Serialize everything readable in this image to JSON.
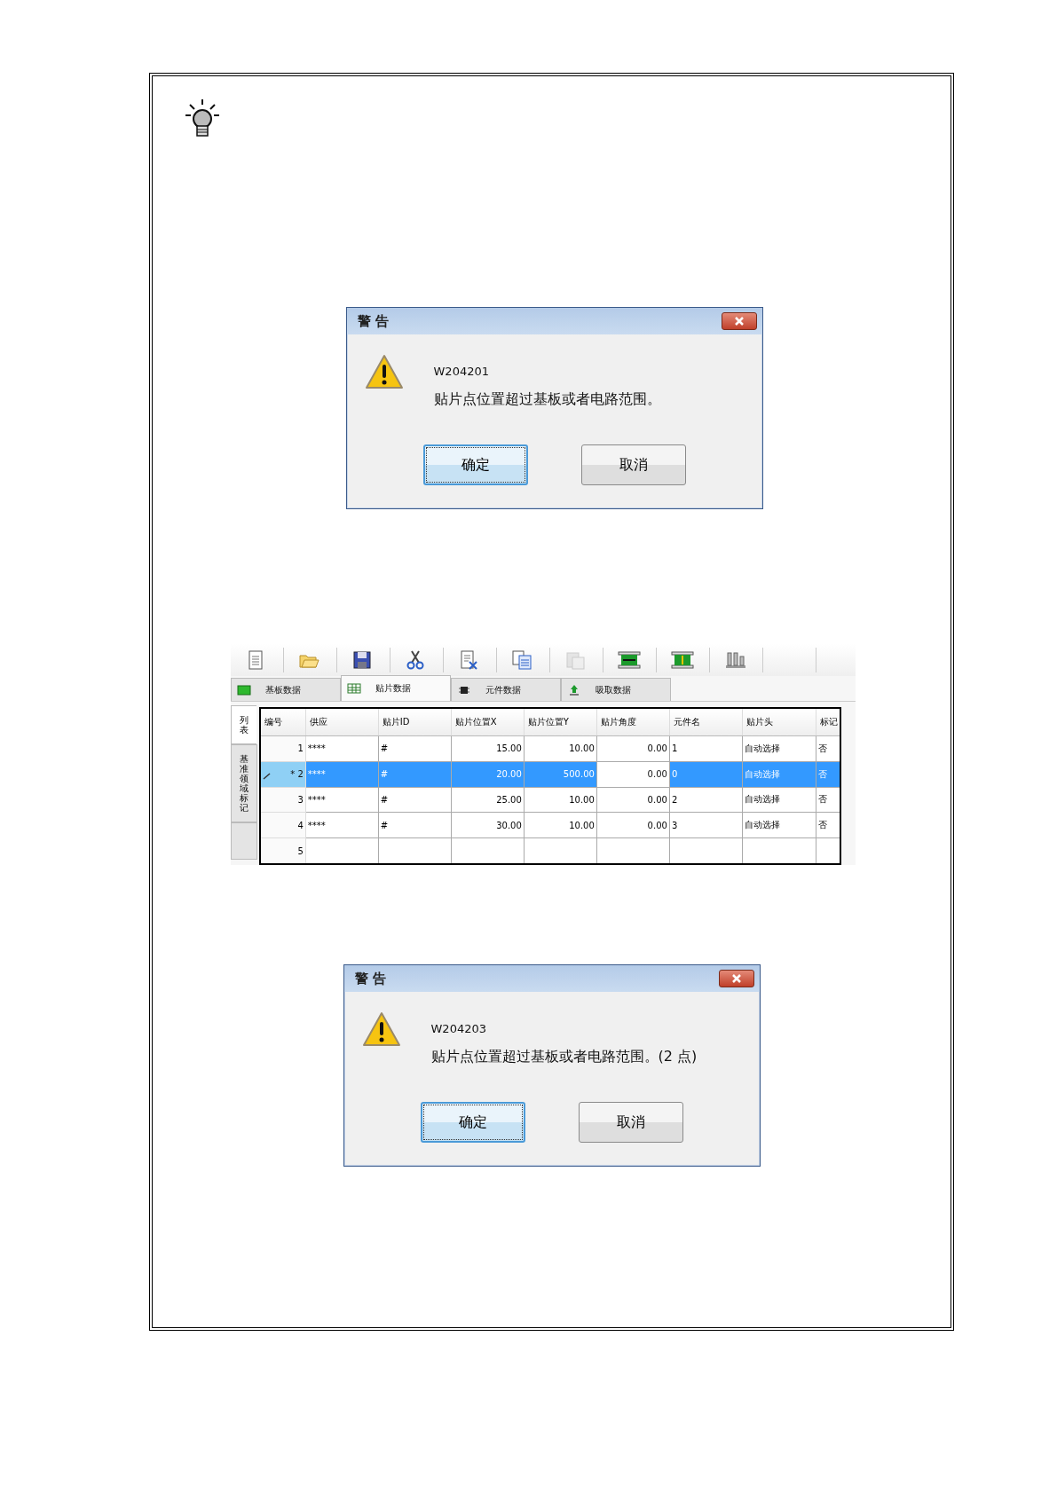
{
  "dialogs_top": {
    "title": "警 告",
    "code": "W204201",
    "message": "贴片点位置超过基板或者电路范围。",
    "buttons": [
      {
        "label": "确定",
        "focused": true
      },
      {
        "label": "取消",
        "focused": false
      }
    ]
  },
  "editor": {
    "toolbar": [
      {
        "kind": "new",
        "disabled": false
      },
      {
        "kind": "open",
        "disabled": false
      },
      {
        "kind": "save",
        "disabled": false
      },
      {
        "kind": "cut",
        "disabled": false
      },
      {
        "kind": "delete",
        "disabled": false
      },
      {
        "kind": "copy",
        "disabled": false
      },
      {
        "kind": "paste",
        "disabled": true
      },
      {
        "kind": "horizontal",
        "disabled": false
      },
      {
        "kind": "vertical",
        "disabled": false
      },
      {
        "kind": "nozzles",
        "disabled": false
      },
      {
        "kind": "blank",
        "disabled": false
      }
    ],
    "tabs": [
      {
        "label": "基板数据",
        "selected": false
      },
      {
        "label": "贴片数据",
        "selected": true
      },
      {
        "label": "元件数据",
        "selected": false
      },
      {
        "label": "吸取数据",
        "selected": false
      }
    ],
    "side_tabs": [
      {
        "label": "列表",
        "selected": true
      },
      {
        "label": "基准领域标记",
        "selected": false
      },
      {
        "selected": false
      }
    ],
    "table": {
      "columns": [
        "编号",
        "供应",
        "贴片ID",
        "贴片位置X",
        "贴片位置Y",
        "贴片角度",
        "元件名",
        "贴片头",
        "标记"
      ],
      "rows": [
        {
          "selected": false,
          "editing": false,
          "cells": [
            "1",
            "****",
            "#",
            "15.00",
            "10.00",
            "0.00",
            "1",
            "自动选择",
            "否"
          ]
        },
        {
          "selected": true,
          "editing": true,
          "cells": [
            "* 2",
            "****",
            "#",
            "20.00",
            "500.00",
            "0.00",
            "0",
            "自动选择",
            "否"
          ]
        },
        {
          "selected": false,
          "editing": false,
          "cells": [
            "3",
            "****",
            "#",
            "25.00",
            "10.00",
            "0.00",
            "2",
            "自动选择",
            "否"
          ]
        },
        {
          "selected": false,
          "editing": false,
          "cells": [
            "4",
            "****",
            "#",
            "30.00",
            "10.00",
            "0.00",
            "3",
            "自动选择",
            "否"
          ]
        },
        {
          "selected": false,
          "editing": false,
          "cells": [
            "5",
            "",
            "",
            "",
            "",
            "",
            "",
            "",
            ""
          ]
        }
      ]
    }
  },
  "dialogs_bottom": {
    "title": "警 告",
    "code": "W204203",
    "message": "贴片点位置超过基板或者电路范围。(2 点)",
    "buttons": [
      {
        "label": "确定",
        "focused": true
      },
      {
        "label": "取消",
        "focused": false
      }
    ]
  }
}
